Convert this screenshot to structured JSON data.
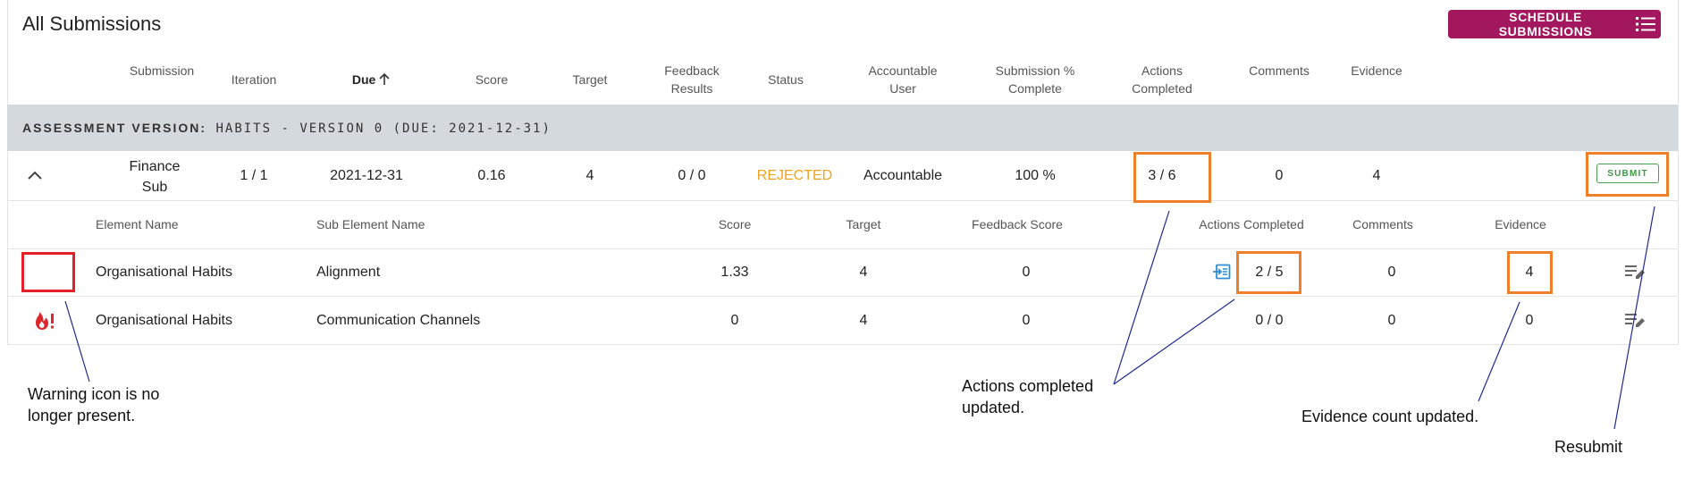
{
  "header": {
    "title": "All Submissions",
    "schedule_button": "SCHEDULE SUBMISSIONS"
  },
  "columns": {
    "submission": "Submission",
    "iteration": "Iteration",
    "due": "Due",
    "score": "Score",
    "target": "Target",
    "feedback_line1": "Feedback",
    "feedback_line2": "Results",
    "status": "Status",
    "accountable_line1": "Accountable",
    "accountable_line2": "User",
    "pct_line1": "Submission %",
    "pct_line2": "Complete",
    "actions_line1": "Actions",
    "actions_line2": "Completed",
    "comments": "Comments",
    "evidence": "Evidence"
  },
  "group": {
    "label_bold": "ASSESSMENT VERSION:",
    "label_rest": "HABITS - VERSION 0 (DUE: 2021-12-31)"
  },
  "submission_row": {
    "name_line1": "Finance",
    "name_line2": "Sub",
    "iteration": "1 / 1",
    "due": "2021-12-31",
    "score": "0.16",
    "target": "4",
    "feedback": "0 / 0",
    "status": "REJECTED",
    "accountable": "Accountable",
    "pct_complete": "100 %",
    "actions": "3 / 6",
    "comments": "0",
    "evidence": "4",
    "submit_label": "SUBMIT"
  },
  "sub_columns": {
    "element": "Element Name",
    "sub_element": "Sub Element Name",
    "score": "Score",
    "target": "Target",
    "feedback": "Feedback Score",
    "actions": "Actions Completed",
    "comments": "Comments",
    "evidence": "Evidence"
  },
  "elements": [
    {
      "element": "Organisational Habits",
      "sub_element": "Alignment",
      "score": "1.33",
      "target": "4",
      "feedback": "0",
      "actions": "2 / 5",
      "comments": "0",
      "evidence": "4"
    },
    {
      "element": "Organisational Habits",
      "sub_element": "Communication Channels",
      "score": "0",
      "target": "4",
      "feedback": "0",
      "actions": "0 / 0",
      "comments": "0",
      "evidence": "0"
    }
  ],
  "annotations": {
    "warning_line1": "Warning icon is no",
    "warning_line2": "longer present.",
    "actions_line1": "Actions completed",
    "actions_line2": "updated.",
    "evidence": "Evidence count updated.",
    "resubmit": "Resubmit"
  },
  "icons": {
    "sort": "arrow-up-icon",
    "schedule": "list-icon",
    "expand": "chevron-up-icon",
    "warning": "fire-warning-icon",
    "actions_link": "open-in-icon",
    "edit": "edit-list-icon"
  },
  "colors": {
    "accent": "#a3175e",
    "rejected": "#f0a21c",
    "submit": "#3a9a41",
    "highlight": "#f07f2a",
    "warning": "#e41f26",
    "annotation_line": "#1f2a8f"
  }
}
